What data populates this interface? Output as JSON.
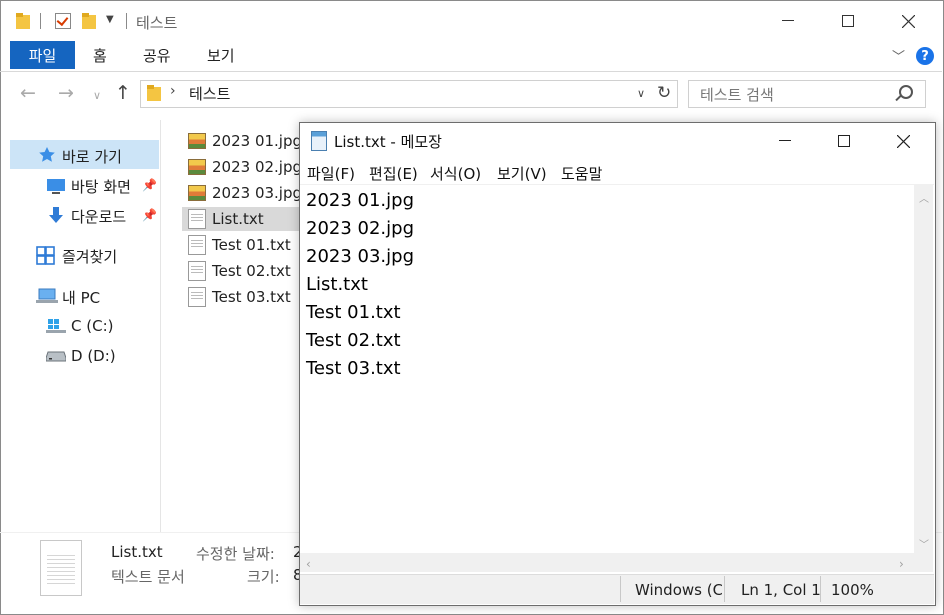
{
  "explorer": {
    "window_title": "테스트",
    "ribbon_tabs": [
      "파일",
      "홈",
      "공유",
      "보기"
    ],
    "address_path": "테스트",
    "search_placeholder": "테스트 검색",
    "sidebar": {
      "quick_access": "바로 가기",
      "desktop": "바탕 화면",
      "downloads": "다운로드",
      "favorites": "즐겨찾기",
      "this_pc": "내 PC",
      "drive_c": "C (C:)",
      "drive_d": "D (D:)"
    },
    "files": [
      {
        "name": "2023 01.jpg",
        "type": "image"
      },
      {
        "name": "2023 02.jpg",
        "type": "image"
      },
      {
        "name": "2023 03.jpg",
        "type": "image"
      },
      {
        "name": "List.txt",
        "type": "text",
        "selected": true
      },
      {
        "name": "Test 01.txt",
        "type": "text"
      },
      {
        "name": "Test 02.txt",
        "type": "text"
      },
      {
        "name": "Test 03.txt",
        "type": "text"
      }
    ],
    "details": {
      "file_name": "List.txt",
      "file_type": "텍스트 문서",
      "modified_label": "수정한 날짜:",
      "modified_value": "2",
      "size_label": "크기:",
      "size_value": "8"
    }
  },
  "notepad": {
    "title": "List.txt - 메모장",
    "menu": [
      "파일(F)",
      "편집(E)",
      "서식(O)",
      "보기(V)",
      "도움말"
    ],
    "lines": [
      "2023 01.jpg",
      "2023 02.jpg",
      "2023 03.jpg",
      "List.txt",
      "Test 01.txt",
      "Test 02.txt",
      "Test 03.txt"
    ],
    "status": {
      "encoding": "Windows (CR",
      "position": "Ln 1, Col 1",
      "zoom": "100%"
    }
  },
  "colors": {
    "ribbon_file_tab": "#1565c0",
    "sidebar_selected": "#cce4f7",
    "file_selected": "#d9d9d9",
    "help_icon": "#1a73e8"
  }
}
